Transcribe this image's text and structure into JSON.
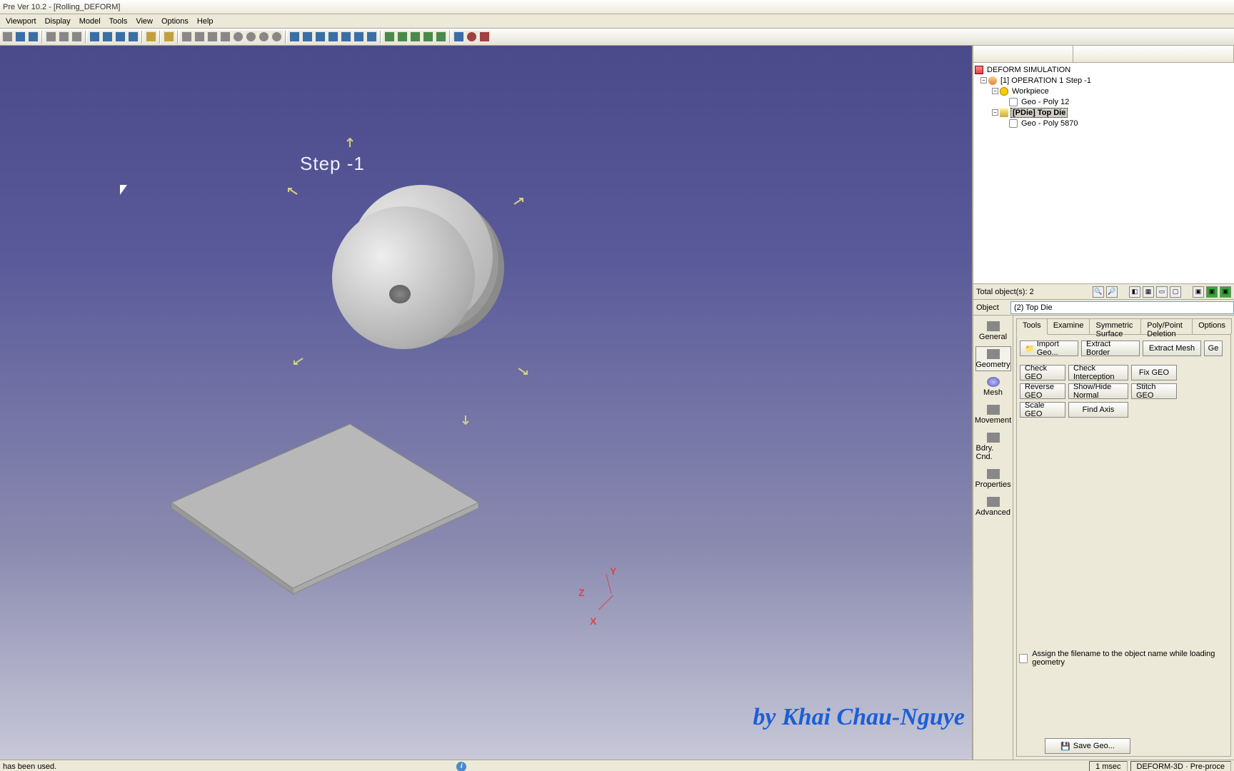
{
  "title": "Pre Ver 10.2 - [Rolling_DEFORM]",
  "menu": [
    "Viewport",
    "Display",
    "Model",
    "Tools",
    "View",
    "Options",
    "Help"
  ],
  "viewport": {
    "step_label": "Step   -1",
    "axes": {
      "x": "X",
      "y": "Y",
      "z": "Z"
    },
    "watermark": "by Khai Chau-Nguye"
  },
  "tree": {
    "root": "DEFORM SIMULATION",
    "operation": "[1] OPERATION 1  Step -1",
    "workpiece": "Workpiece",
    "workpiece_geo": "Geo - Poly 12",
    "topdie": "[PDie] Top Die",
    "topdie_geo": "Geo - Poly 5870"
  },
  "total_objects": "Total object(s): 2",
  "object_row": {
    "label": "Object",
    "value": "(2) Top Die"
  },
  "side_tabs": [
    "General",
    "Geometry",
    "Mesh",
    "Movement",
    "Bdry. Cnd.",
    "Properties",
    "Advanced"
  ],
  "inner_tabs": [
    "Tools",
    "Examine",
    "Symmetric Surface",
    "Poly/Point Deletion",
    "Options"
  ],
  "geom_buttons": {
    "import": "Import Geo...",
    "extract_border": "Extract Border",
    "extract_mesh": "Extract Mesh",
    "ge": "Ge",
    "check_geo": "Check GEO",
    "check_interception": "Check Interception",
    "fix_geo": "Fix GEO",
    "reverse_geo": "Reverse GEO",
    "show_hide_normal": "Show/Hide Normal",
    "stitch_geo": "Stitch GEO",
    "scale_geo": "Scale GEO",
    "find_axis": "Find Axis"
  },
  "assign_checkbox": "Assign the filename to the object name while loading geometry",
  "save_geo": "Save Geo...",
  "status": {
    "left": "has been used.",
    "time": "1 msec",
    "mode": "DEFORM-3D  ·  Pre-proce"
  }
}
